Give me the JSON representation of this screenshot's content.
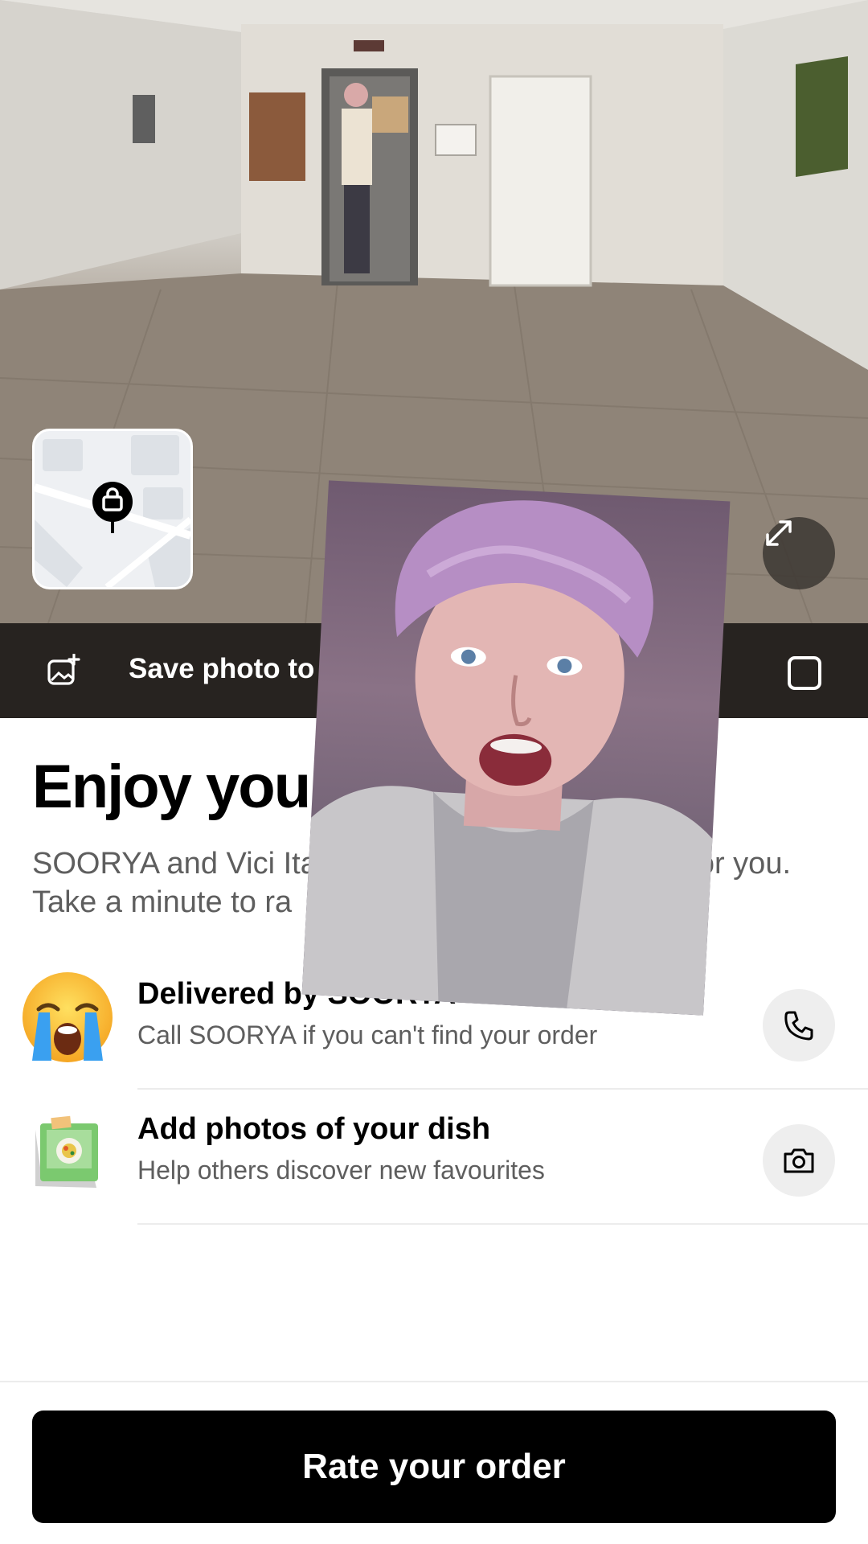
{
  "photo": {
    "map_thumb_icon": "bag-pin-icon",
    "expand_icon": "expand-arrows-icon"
  },
  "save_bar": {
    "icon": "add-image-icon",
    "label": "Save photo to g",
    "checkbox_checked": false
  },
  "content": {
    "title": "Enjoy your",
    "subtitle_line1": "SOORYA and Vici Ita                                         c for you.",
    "subtitle_line2": "Take a minute to ra"
  },
  "rows": [
    {
      "title": "Delivered by SOORYA",
      "subtitle": "Call SOORYA if you can't find your order",
      "icon": "crying-face-emoji",
      "action_icon": "phone-icon"
    },
    {
      "title": "Add photos of your dish",
      "subtitle": "Help others discover new favourites",
      "icon": "dish-photo-icon",
      "action_icon": "camera-icon"
    }
  ],
  "rate_button": {
    "label": "Rate your order"
  }
}
